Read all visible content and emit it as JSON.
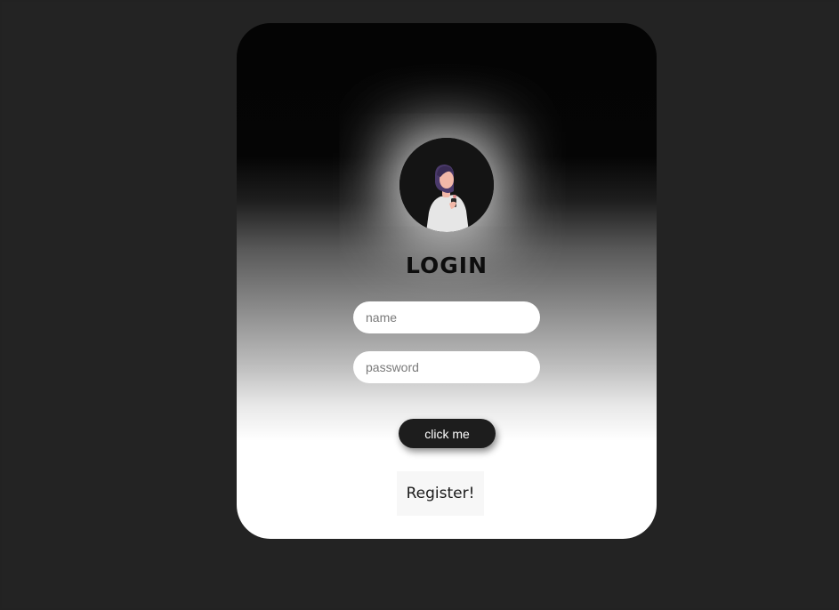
{
  "login": {
    "title": "LOGIN",
    "name_placeholder": "name",
    "password_placeholder": "password",
    "submit_label": "click me",
    "register_label": "Register!"
  },
  "avatar": {
    "icon": "user-avatar-illustration"
  },
  "colors": {
    "page_background": "#222222",
    "card_top": "#040404",
    "card_bottom": "#ffffff",
    "button_background": "#1d1d1d",
    "button_text": "#ffffff"
  }
}
